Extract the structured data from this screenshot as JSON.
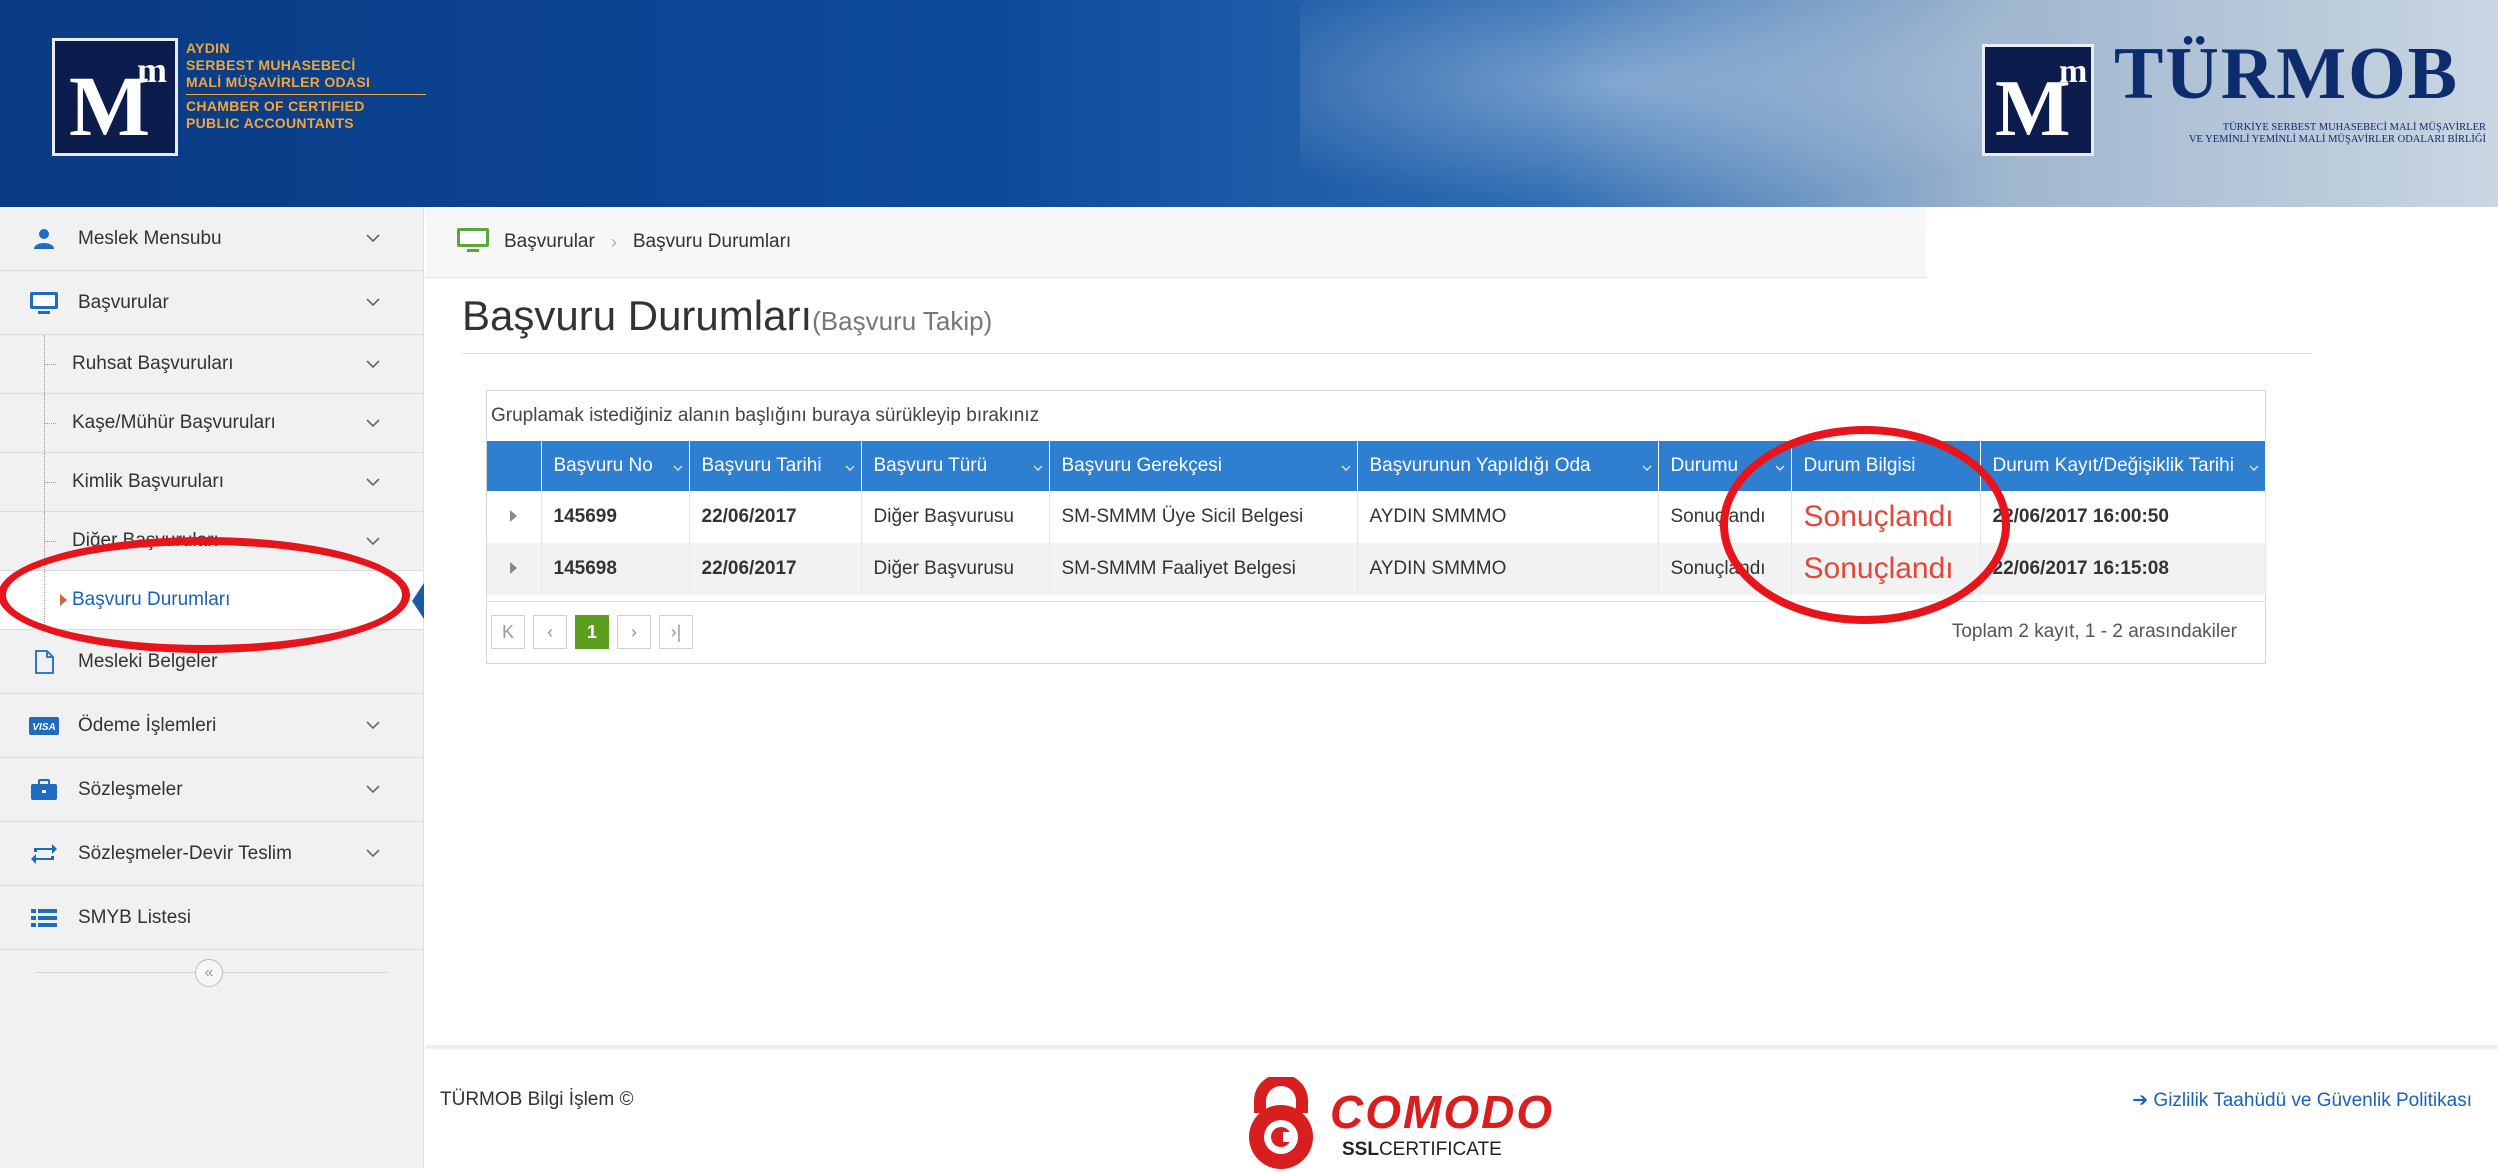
{
  "header": {
    "left_org_lines": [
      "AYDIN",
      "SERBEST MUHASEBECİ",
      "MALİ MÜŞAVİRLER ODASI",
      "CHAMBER OF CERTIFIED",
      "PUBLIC ACCOUNTANTS"
    ],
    "logo_letter": "M",
    "logo_sup": "m",
    "turmob_word": "TÜRMOB",
    "turmob_sub_1": "TÜRKİYE SERBEST MUHASEBECİ MALİ MÜŞAVİRLER",
    "turmob_sub_2": "VE YEMİNLİ YEMİNLİ MALİ MÜŞAVİRLER ODALARI BİRLİĞİ"
  },
  "sidebar": {
    "items": [
      {
        "label": "Meslek Mensubu",
        "icon": "user-icon"
      },
      {
        "label": "Başvurular",
        "icon": "monitor-icon"
      }
    ],
    "sub_items": [
      {
        "label": "Ruhsat Başvuruları"
      },
      {
        "label": "Kaşe/Mühür Başvuruları"
      },
      {
        "label": "Kimlik Başvuruları"
      },
      {
        "label": "Diğer Başvuruları"
      },
      {
        "label": "Başvuru Durumları"
      }
    ],
    "items_after": [
      {
        "label": "Mesleki Belgeler",
        "icon": "document-icon"
      },
      {
        "label": "Ödeme İşlemleri",
        "icon": "visa-icon",
        "visa_text": "VISA"
      },
      {
        "label": "Sözleşmeler",
        "icon": "briefcase-icon"
      },
      {
        "label": "Sözleşmeler-Devir Teslim",
        "icon": "transfer-icon"
      },
      {
        "label": "SMYB Listesi",
        "icon": "list-icon"
      }
    ],
    "collapse_glyph": "«"
  },
  "breadcrumb": {
    "items": [
      "Başvurular",
      "Başvuru Durumları"
    ],
    "separator": "›"
  },
  "page": {
    "title": "Başvuru Durumları",
    "subtitle": "(Başvuru Takip)"
  },
  "grid": {
    "group_hint": "Gruplamak istediğiniz alanın başlığını buraya sürükleyip bırakınız",
    "columns": [
      "Başvuru No",
      "Başvuru Tarihi",
      "Başvuru Türü",
      "Başvuru Gerekçesi",
      "Başvurunun Yapıldığı Oda",
      "Durumu",
      "Durum Bilgisi",
      "Durum Kayıt/Değişiklik Tarihi"
    ],
    "rows": [
      {
        "no": "145699",
        "date": "22/06/2017",
        "type": "Diğer Başvurusu",
        "reason": "SM-SMMM Üye Sicil Belgesi",
        "room": "AYDIN SMMMO",
        "status": "Sonuçlandı",
        "status_info": "Sonuçlandı",
        "changed": "22/06/2017 16:00:50"
      },
      {
        "no": "145698",
        "date": "22/06/2017",
        "type": "Diğer Başvurusu",
        "reason": "SM-SMMM Faaliyet Belgesi",
        "room": "AYDIN SMMMO",
        "status": "Sonuçlandı",
        "status_info": "Sonuçlandı",
        "changed": "22/06/2017 16:15:08"
      }
    ],
    "pager": {
      "first": "K",
      "prev": "‹",
      "current": "1",
      "next": "›",
      "last": "›|",
      "info": "Toplam 2 kayıt, 1 - 2 arasındakiler"
    }
  },
  "footer": {
    "copyright": "TÜRMOB Bilgi İşlem ©",
    "comodo_word": "COMODO",
    "comodo_ssl_bold": "SSL",
    "comodo_ssl_rest": "CERTIFICATE",
    "privacy_link": "Gizlilik Taahüdü ve Güvenlik Politikası"
  },
  "colors": {
    "header_blue": "#0d4a9c",
    "grid_header": "#2f7fd1",
    "status_red": "#e2473a",
    "pager_active": "#5c9e1e",
    "annotation_red": "#e8141b"
  }
}
